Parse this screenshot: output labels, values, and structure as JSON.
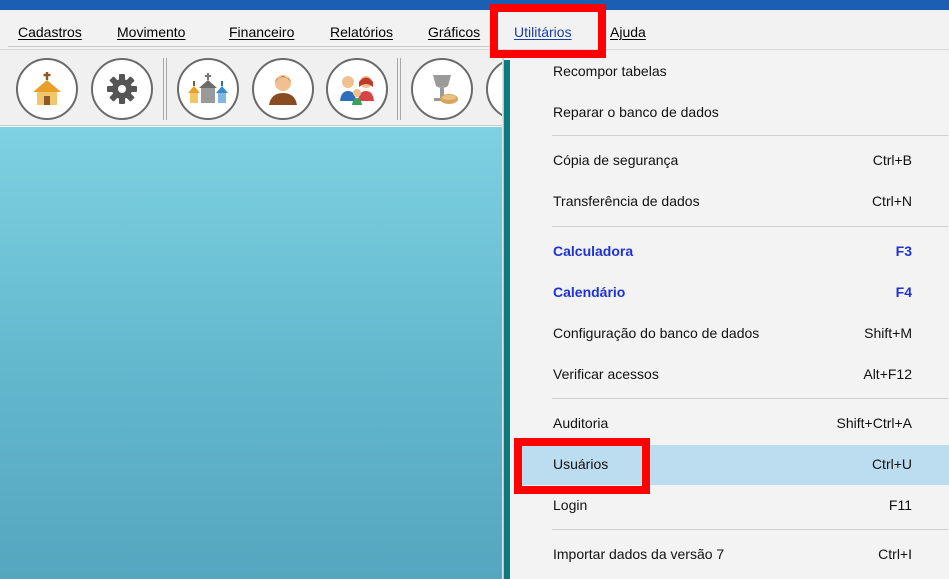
{
  "menubar": {
    "items": [
      {
        "label": "Cadastros"
      },
      {
        "label": "Movimento"
      },
      {
        "label": "Financeiro"
      },
      {
        "label": "Relatórios"
      },
      {
        "label": "Gráficos"
      },
      {
        "label": "Utilitários"
      },
      {
        "label": "Ajuda"
      }
    ],
    "active": "Utilitários"
  },
  "toolbar": {
    "icons": [
      "church-icon",
      "settings-gear-icon",
      "churches-icon",
      "member-person-icon",
      "family-icon",
      "communion-icon"
    ]
  },
  "dropdown": {
    "items": [
      {
        "label": "Recompor tabelas",
        "shortcut": ""
      },
      {
        "label": "Reparar o banco de dados",
        "shortcut": ""
      },
      {
        "label": "Cópia de segurança",
        "shortcut": "Ctrl+B"
      },
      {
        "label": "Transferência de dados",
        "shortcut": "Ctrl+N"
      },
      {
        "label": "Calculadora",
        "shortcut": "F3"
      },
      {
        "label": "Calendário",
        "shortcut": "F4"
      },
      {
        "label": "Configuração do banco de dados",
        "shortcut": "Shift+M"
      },
      {
        "label": "Verificar acessos",
        "shortcut": "Alt+F12"
      },
      {
        "label": "Auditoria",
        "shortcut": "Shift+Ctrl+A"
      },
      {
        "label": "Usuários",
        "shortcut": "Ctrl+U"
      },
      {
        "label": "Login",
        "shortcut": "F11"
      },
      {
        "label": "Importar dados da versão 7",
        "shortcut": "Ctrl+I"
      }
    ],
    "hovered": "Usuários"
  },
  "colors": {
    "title_bar": "#1a5fb4",
    "highlight": "#ff0000",
    "menu_stripe": "#0a7b7e",
    "hover": "#bcdcf0",
    "bold_item": "#1f33d4",
    "workspace_top": "#7dd1e0",
    "workspace_bottom": "#55a6c0"
  }
}
